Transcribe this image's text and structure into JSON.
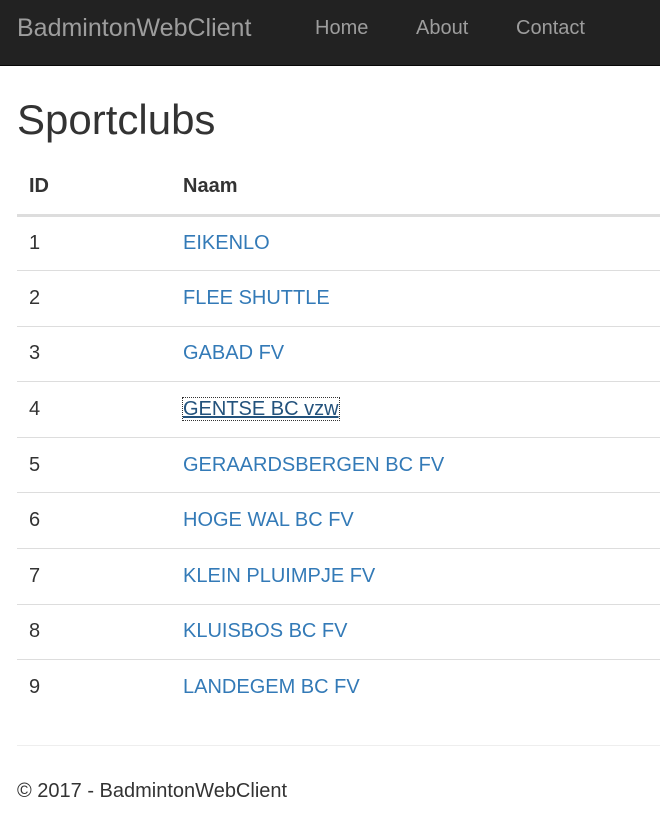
{
  "navbar": {
    "brand": "BadmintonWebClient",
    "links": [
      "Home",
      "About",
      "Contact"
    ],
    "background": "#222222",
    "text_color": "#9d9d9d"
  },
  "main": {
    "title": "Sportclubs",
    "table": {
      "headers": [
        "ID",
        "Naam"
      ],
      "rows": [
        {
          "id": "1",
          "name": "EIKENLO"
        },
        {
          "id": "2",
          "name": "FLEE SHUTTLE"
        },
        {
          "id": "3",
          "name": "GABAD FV"
        },
        {
          "id": "4",
          "name": "GENTSE BC vzw"
        },
        {
          "id": "5",
          "name": "GERAARDSBERGEN BC FV"
        },
        {
          "id": "6",
          "name": "HOGE WAL BC FV"
        },
        {
          "id": "7",
          "name": "KLEIN PLUIMPJE FV"
        },
        {
          "id": "8",
          "name": "KLUISBOS BC FV"
        },
        {
          "id": "9",
          "name": "LANDEGEM BC FV"
        }
      ],
      "link_color": "#337ab7"
    }
  },
  "footer": {
    "text": "© 2017 - BadmintonWebClient"
  }
}
